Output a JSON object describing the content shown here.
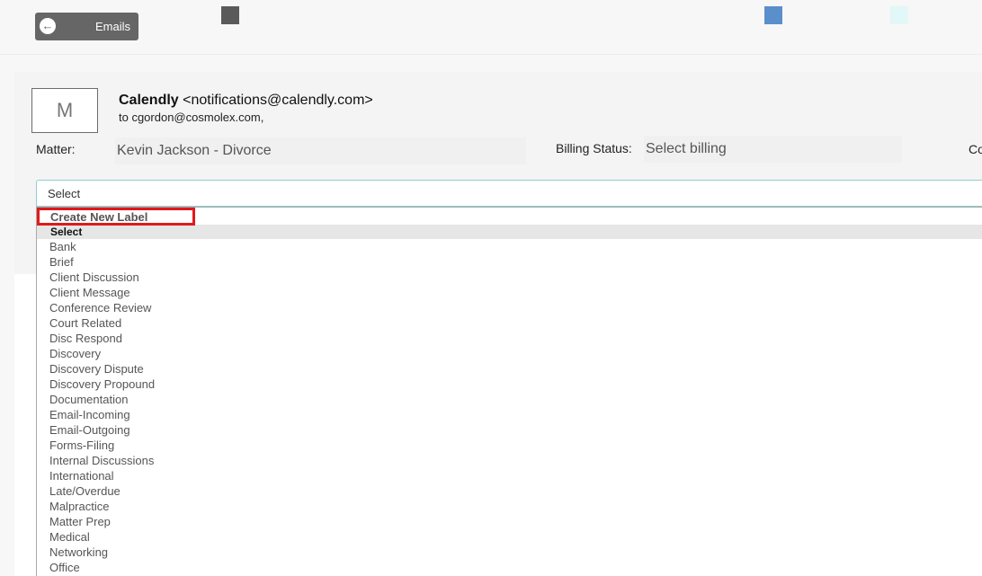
{
  "toolbar": {
    "back_label": "Emails",
    "back_icon": "arrow-left-circle-icon",
    "square_colors": [
      "#5a5a5a",
      "#5b8fcb",
      "#e2f7f8"
    ]
  },
  "email": {
    "avatar_letter": "M",
    "sender_name": "Calendly",
    "sender_email": "<notifications@calendly.com>",
    "to_line": "to cgordon@cosmolex.com,"
  },
  "fields": {
    "matter_label": "Matter:",
    "matter_value": "Kevin Jackson - Divorce",
    "billing_label": "Billing Status:",
    "billing_value": "Select billing",
    "cut_label": "Co"
  },
  "label_select": {
    "value": "Select",
    "create_new": "Create New Label",
    "selected_option": "Select",
    "options": [
      "Bank",
      "Brief",
      "Client Discussion",
      "Client Message",
      "Conference Review",
      "Court Related",
      "Disc Respond",
      "Discovery",
      "Discovery Dispute",
      "Discovery Propound",
      "Documentation",
      "Email-Incoming",
      "Email-Outgoing",
      "Forms-Filing",
      "Internal Discussions",
      "International",
      "Late/Overdue",
      "Malpractice",
      "Matter Prep",
      "Medical",
      "Networking",
      "Office"
    ]
  },
  "colors": {
    "highlight_border": "#e0191b",
    "select_border": "#8ccfd3",
    "button_bg": "#666666"
  }
}
